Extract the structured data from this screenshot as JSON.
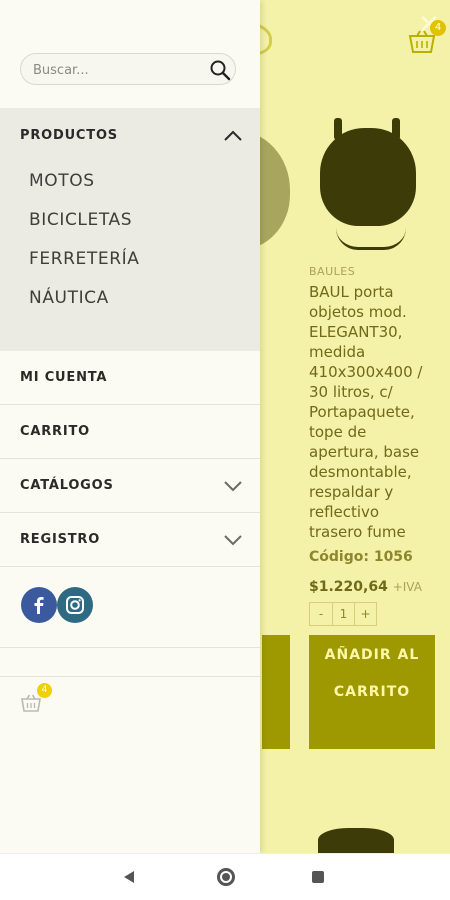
{
  "background": {
    "close_glyph": "✕",
    "cart_count": "4",
    "product": {
      "category": "BAULES",
      "title": "BAUL porta objetos mod. ELEGANT30, medida 410x300x400 / 30 litros, c/ Portapaquete, tope de apertura, base desmontable, respaldar y reflectivo trasero fume",
      "code": "Código: 1056",
      "price": "$1.220,64",
      "price_suffix": "+IVA",
      "qty_minus": "-",
      "qty_value": "1",
      "qty_plus": "+",
      "add_to_cart": "AÑADIR AL CARRITO"
    },
    "overlay_color": "#f4f2a8"
  },
  "drawer": {
    "search": {
      "placeholder": "Buscar...",
      "icon": "search-icon"
    },
    "products": {
      "label": "PRODUCTOS",
      "icon": "chevron-up-icon",
      "items": [
        "MOTOS",
        "BICICLETAS",
        "FERRETERÍA",
        "NÁUTICA"
      ]
    },
    "nav": [
      {
        "label": "MI CUENTA"
      },
      {
        "label": "CARRITO"
      },
      {
        "label": "CATÁLOGOS",
        "icon": "chevron-down-icon"
      },
      {
        "label": "REGISTRO",
        "icon": "chevron-down-icon"
      }
    ],
    "social": [
      {
        "icon": "facebook-icon",
        "color": "#3b5a9d"
      },
      {
        "icon": "instagram-icon",
        "color": "#2e6a82"
      }
    ],
    "cart_count": "4"
  },
  "system_nav": {
    "back": "back-icon",
    "home": "home-icon",
    "recent": "recent-apps-icon"
  }
}
